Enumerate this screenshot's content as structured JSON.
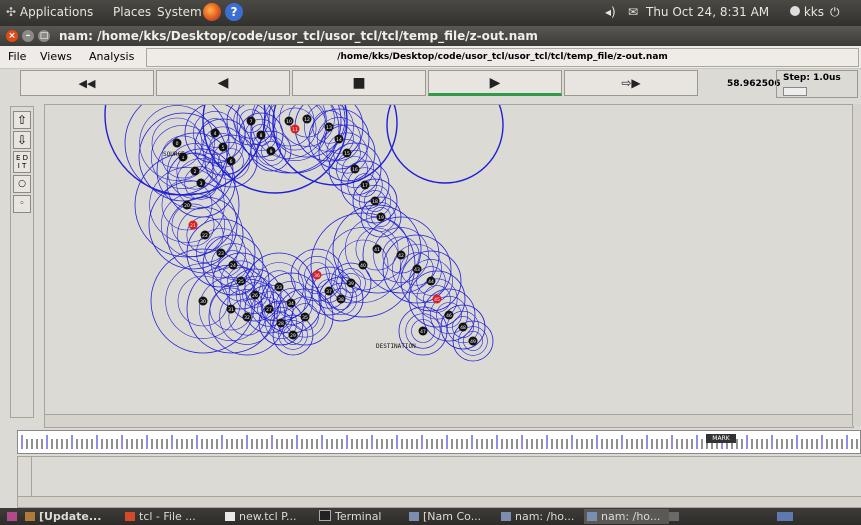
{
  "gnome_panel": {
    "applications": "Applications",
    "places": "Places",
    "system": "System",
    "clock": "Thu Oct 24,  8:31 AM",
    "user": "kks"
  },
  "window": {
    "title": "nam: /home/kks/Desktop/code/usor_tcl/usor_tcl/tcl/temp_file/z-out.nam"
  },
  "menubar": {
    "file": "File",
    "views": "Views",
    "analysis": "Analysis",
    "path": "/home/kks/Desktop/code/usor_tcl/usor_tcl/tcl/temp_file/z-out.nam"
  },
  "controls": {
    "rewind": "◀◀",
    "back": "◀",
    "stop": "■",
    "play": "▶",
    "fastforward": "⇨▶",
    "time": "58.962506",
    "step_label": "Step: 1.0us"
  },
  "left_toolbar": {
    "edit_label": "E D I T"
  },
  "nodes": {
    "source_label": "SOURCE",
    "destination_label": "DESTINATION",
    "numbers": [
      "0",
      "1",
      "2",
      "3",
      "4",
      "5",
      "6",
      "7",
      "8",
      "9",
      "10",
      "11",
      "12",
      "13",
      "14",
      "15",
      "16",
      "17",
      "18",
      "19",
      "20",
      "21",
      "22",
      "23",
      "24",
      "25",
      "26",
      "27",
      "28",
      "29",
      "30",
      "31",
      "32",
      "33",
      "34",
      "35",
      "36",
      "37",
      "38",
      "39",
      "40",
      "41",
      "42",
      "43",
      "44",
      "45",
      "46",
      "47",
      "48",
      "49"
    ]
  },
  "timeline": {
    "marker_label": "MARK"
  },
  "taskbar": {
    "tasks": [
      "[Update...",
      "tcl - File ...",
      "new.tcl P...",
      "Terminal",
      "[Nam Co...",
      "nam: /ho...",
      "nam: /ho..."
    ]
  },
  "colors": {
    "ring": "#1f1fd6",
    "node": "#111111",
    "node_active": "#d42020",
    "play_indicator": "#2f9a4a"
  }
}
